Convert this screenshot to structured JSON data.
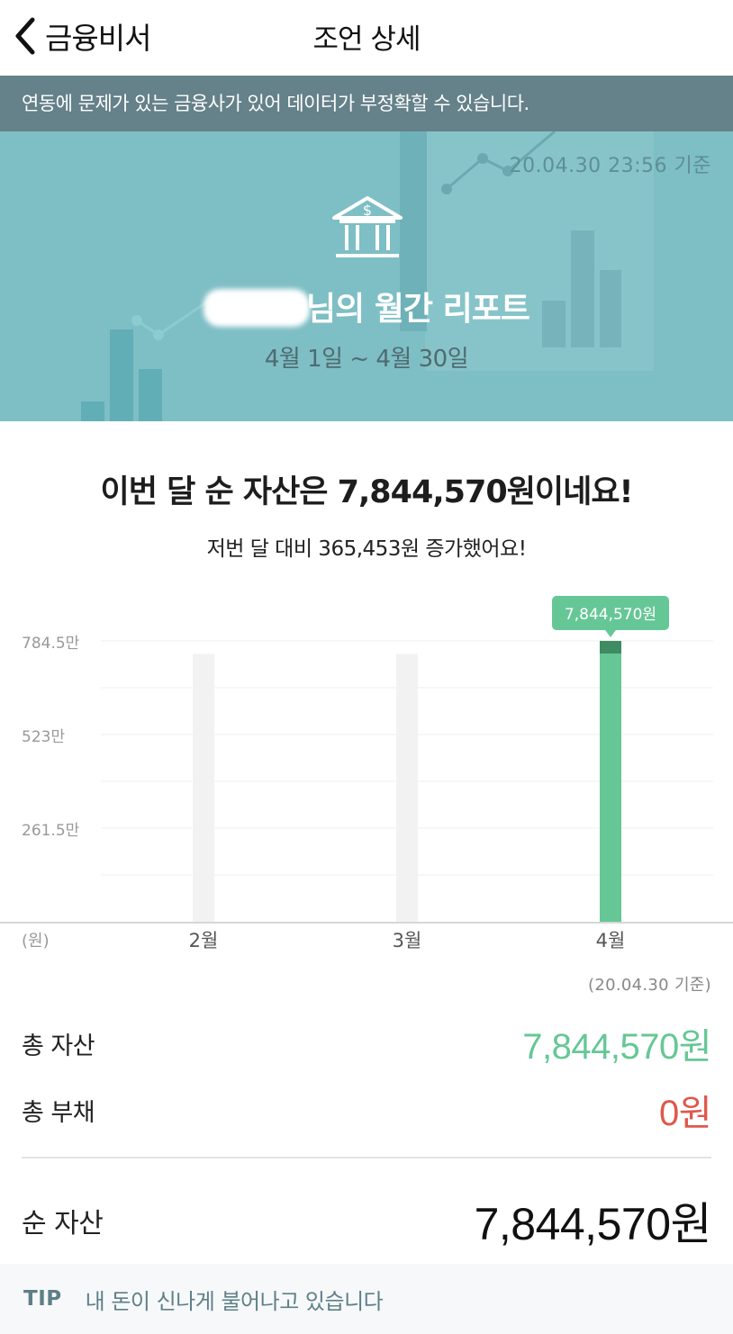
{
  "nav": {
    "back_label": "금융비서",
    "title": "조언 상세"
  },
  "warning": "연동에 문제가 있는 금융사가 있어 데이터가 부정확할 수 있습니다.",
  "hero": {
    "timestamp": "20.04.30 23:56 기준",
    "title_suffix": "님의 월간 리포트",
    "period": "4월 1일 ~ 4월 30일",
    "icon": "bank-icon"
  },
  "headline": "이번 달 순 자산은 7,844,570원이네요!",
  "subline": "저번 달 대비 365,453원 증가했어요!",
  "chart_data": {
    "type": "bar",
    "categories": [
      "2월",
      "3월",
      "4월"
    ],
    "values": [
      7479117,
      7479117,
      7844570
    ],
    "highlight_index": 2,
    "tooltip": "7,844,570원",
    "y_ticks": [
      {
        "value": 2615000,
        "label": "261.5만"
      },
      {
        "value": 5230000,
        "label": "523만"
      },
      {
        "value": 7845000,
        "label": "784.5만"
      }
    ],
    "ylim": [
      0,
      7845000
    ],
    "unit_label": "(원)",
    "grid": true,
    "colors": {
      "active": "#66c796",
      "active_top": "#3f8c62",
      "inactive": "#f2f2f2",
      "tooltip": "#66c796"
    }
  },
  "summary": {
    "basis": "(20.04.30 기준)",
    "total_assets_label": "총 자산",
    "total_assets_value": "7,844,570원",
    "total_debt_label": "총 부채",
    "total_debt_value": "0원",
    "net_assets_label": "순 자산",
    "net_assets_value": "7,844,570원"
  },
  "tip": {
    "tag": "TIP",
    "text": "내 돈이 신나게 불어나고 있습니다"
  }
}
